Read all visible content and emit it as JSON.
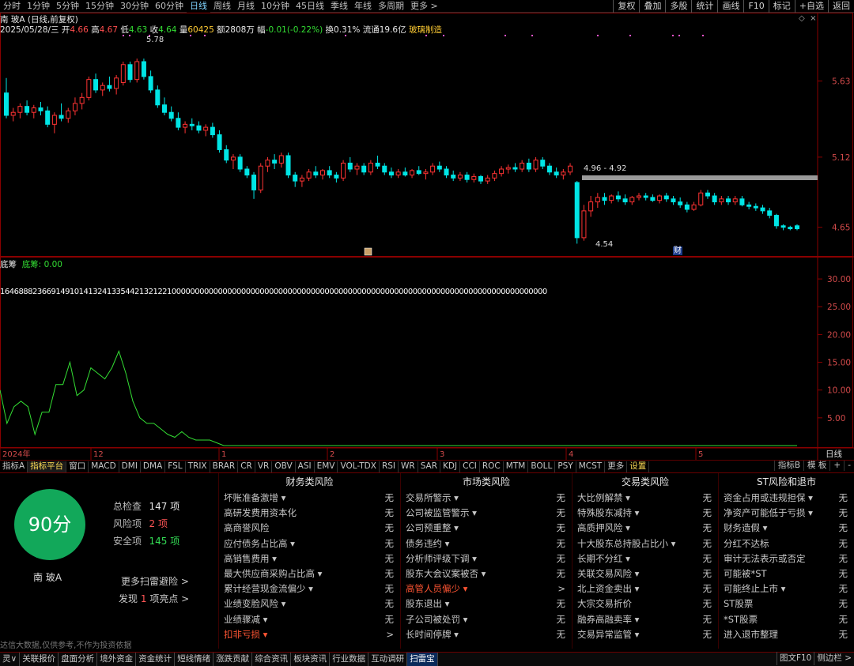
{
  "timeframes": [
    "分时",
    "1分钟",
    "5分钟",
    "15分钟",
    "30分钟",
    "60分钟",
    "日线",
    "周线",
    "月线",
    "10分钟",
    "45日线",
    "季线",
    "年线",
    "多周期",
    "更多 >"
  ],
  "active_timeframe": "日线",
  "top_buttons": [
    "复权",
    "叠加",
    "多股",
    "统计",
    "画线",
    "F10",
    "标记",
    "+自选",
    "返回"
  ],
  "stock": {
    "title": "南 玻A (日线,前复权)",
    "date": "2025/05/28/三",
    "open_label": "开",
    "open": "4.66",
    "high_label": "高",
    "high": "4.67",
    "low_label": "低",
    "low": "4.63",
    "close_label": "收",
    "close": "4.64",
    "vol_label": "量",
    "vol": "60425",
    "amt_label": "额",
    "amt": "2808万",
    "chg_label": "幅",
    "chg": "-0.01(-0.22%)",
    "turnover_label": "换",
    "turnover": "0.31%",
    "float_label": "流通",
    "float": "19.6亿",
    "sector": "玻璃制造"
  },
  "price_axis": [
    "5.63",
    "5.12",
    "4.65"
  ],
  "annotations": {
    "high": "5.78",
    "low": "4.54",
    "gap": "4.96 - 4.92",
    "fin": "财"
  },
  "indicator": {
    "name": "底筹",
    "value_label": "底筹: 0.00",
    "axis": [
      "30.00",
      "25.00",
      "20.00",
      "15.00",
      "10.00",
      "5.00"
    ],
    "digit_row": "1646888236691491014132413354421321221000000000000000000000000000000000000000000000000000000000000000000000000000000000"
  },
  "time_axis": {
    "labels": [
      "2024年",
      "12",
      "1",
      "2",
      "3",
      "4",
      "5"
    ],
    "right": "日线"
  },
  "indicator_tabs": [
    "指标A",
    "指标平台",
    "窗口",
    "MACD",
    "DMI",
    "DMA",
    "FSL",
    "TRIX",
    "BRAR",
    "CR",
    "VR",
    "OBV",
    "ASI",
    "EMV",
    "VOL-TDX",
    "RSI",
    "WR",
    "SAR",
    "KDJ",
    "CCI",
    "ROC",
    "MTM",
    "BOLL",
    "PSY",
    "MCST",
    "更多",
    "设置"
  ],
  "indicator_tabs_right": [
    "指标B",
    "模 板",
    "+",
    "-"
  ],
  "risk": {
    "score": "90分",
    "name": "南 玻A",
    "total_label": "总检查",
    "total": "147 项",
    "risk_label": "风险项",
    "risk_count": "2 项",
    "safe_label": "安全项",
    "safe_count": "145 项",
    "more": "更多扫雷避险 >",
    "found_prefix": "发现",
    "found_num": "1",
    "found_suffix": "项亮点 >",
    "columns": [
      {
        "title": "财务类风险",
        "rows": [
          {
            "name": "坏账准备激增 ▾",
            "val": "无"
          },
          {
            "name": "高研发费用资本化",
            "val": "无"
          },
          {
            "name": "高商誉风险",
            "val": "无"
          },
          {
            "name": "应付债务占比高 ▾",
            "val": "无"
          },
          {
            "name": "高销售费用 ▾",
            "val": "无"
          },
          {
            "name": "最大供应商采购占比高 ▾",
            "val": "无"
          },
          {
            "name": "累计经营现金流偏少 ▾",
            "val": "无"
          },
          {
            "name": "业绩变脸风险 ▾",
            "val": "无"
          },
          {
            "name": "业绩骤减 ▾",
            "val": "无"
          },
          {
            "name": "扣非亏损 ▾",
            "val": ">",
            "hot": true
          }
        ]
      },
      {
        "title": "市场类风险",
        "rows": [
          {
            "name": "交易所警示 ▾",
            "val": "无"
          },
          {
            "name": "公司被监管警示 ▾",
            "val": "无"
          },
          {
            "name": "公司预重整 ▾",
            "val": "无"
          },
          {
            "name": "债务违约 ▾",
            "val": "无"
          },
          {
            "name": "分析师评级下调 ▾",
            "val": "无"
          },
          {
            "name": "股东大会议案被否 ▾",
            "val": "无"
          },
          {
            "name": "高管人员偏少 ▾",
            "val": ">",
            "hot": true
          },
          {
            "name": "股东退出 ▾",
            "val": "无"
          },
          {
            "name": "子公司被处罚 ▾",
            "val": "无"
          },
          {
            "name": "长时间停牌 ▾",
            "val": "无"
          }
        ]
      },
      {
        "title": "交易类风险",
        "rows": [
          {
            "name": "大比例解禁 ▾",
            "val": "无"
          },
          {
            "name": "特殊股东减持 ▾",
            "val": "无"
          },
          {
            "name": "高质押风险 ▾",
            "val": "无"
          },
          {
            "name": "十大股东总持股占比小 ▾",
            "val": "无"
          },
          {
            "name": "长期不分红 ▾",
            "val": "无"
          },
          {
            "name": "关联交易风险 ▾",
            "val": "无"
          },
          {
            "name": "北上资金卖出 ▾",
            "val": "无"
          },
          {
            "name": "大宗交易折价",
            "val": "无"
          },
          {
            "name": "融券高融卖率 ▾",
            "val": "无"
          },
          {
            "name": "交易异常监管 ▾",
            "val": "无"
          }
        ]
      },
      {
        "title": "ST风险和退市",
        "rows": [
          {
            "name": "资金占用或违规担保 ▾",
            "val": "无"
          },
          {
            "name": "净资产可能低于亏损 ▾",
            "val": "无"
          },
          {
            "name": "财务造假 ▾",
            "val": "无"
          },
          {
            "name": "分红不达标",
            "val": "无"
          },
          {
            "name": "审计无法表示或否定",
            "val": "无"
          },
          {
            "name": "可能被*ST",
            "val": "无"
          },
          {
            "name": "可能终止上市 ▾",
            "val": "无"
          },
          {
            "name": "ST股票",
            "val": "无"
          },
          {
            "name": "*ST股票",
            "val": "无"
          },
          {
            "name": "进入退市整理",
            "val": "无"
          }
        ]
      }
    ],
    "disclaimer": "达信大数据,仅供参考,不作为投资依据"
  },
  "bottom_tabs": [
    "灵∨",
    "关联报价",
    "盘面分析",
    "境外资金",
    "资金统计",
    "短线情绪",
    "涨跌贡献",
    "综合资讯",
    "板块资讯",
    "行业数据",
    "互动调研",
    "扫雷宝"
  ],
  "bottom_active": "扫雷宝",
  "bottom_right": [
    "图文F10",
    "侧边栏 >"
  ],
  "colors": {
    "up": "#ff3333",
    "down": "#00e5e5",
    "indicator_line": "#33dd33",
    "frame": "#8a0000",
    "score_bg": "#12a85a"
  },
  "chart_data": {
    "type": "candlestick",
    "ylim": [
      4.5,
      5.85
    ],
    "candles": [
      {
        "o": 5.55,
        "h": 5.65,
        "l": 5.38,
        "c": 5.4
      },
      {
        "o": 5.4,
        "h": 5.45,
        "l": 5.36,
        "c": 5.42
      },
      {
        "o": 5.42,
        "h": 5.48,
        "l": 5.38,
        "c": 5.46
      },
      {
        "o": 5.46,
        "h": 5.5,
        "l": 5.4,
        "c": 5.42
      },
      {
        "o": 5.42,
        "h": 5.47,
        "l": 5.38,
        "c": 5.45
      },
      {
        "o": 5.45,
        "h": 5.49,
        "l": 5.4,
        "c": 5.43
      },
      {
        "o": 5.43,
        "h": 5.46,
        "l": 5.32,
        "c": 5.34
      },
      {
        "o": 5.34,
        "h": 5.42,
        "l": 5.28,
        "c": 5.4
      },
      {
        "o": 5.4,
        "h": 5.48,
        "l": 5.36,
        "c": 5.38
      },
      {
        "o": 5.38,
        "h": 5.45,
        "l": 5.35,
        "c": 5.43
      },
      {
        "o": 5.43,
        "h": 5.52,
        "l": 5.4,
        "c": 5.48
      },
      {
        "o": 5.48,
        "h": 5.55,
        "l": 5.44,
        "c": 5.52
      },
      {
        "o": 5.52,
        "h": 5.66,
        "l": 5.5,
        "c": 5.64
      },
      {
        "o": 5.64,
        "h": 5.68,
        "l": 5.55,
        "c": 5.57
      },
      {
        "o": 5.57,
        "h": 5.62,
        "l": 5.53,
        "c": 5.6
      },
      {
        "o": 5.6,
        "h": 5.66,
        "l": 5.56,
        "c": 5.58
      },
      {
        "o": 5.58,
        "h": 5.67,
        "l": 5.54,
        "c": 5.65
      },
      {
        "o": 5.62,
        "h": 5.76,
        "l": 5.6,
        "c": 5.74
      },
      {
        "o": 5.74,
        "h": 5.76,
        "l": 5.62,
        "c": 5.64
      },
      {
        "o": 5.64,
        "h": 5.78,
        "l": 5.62,
        "c": 5.76
      },
      {
        "o": 5.76,
        "h": 5.78,
        "l": 5.64,
        "c": 5.66
      },
      {
        "o": 5.66,
        "h": 5.7,
        "l": 5.55,
        "c": 5.57
      },
      {
        "o": 5.57,
        "h": 5.6,
        "l": 5.45,
        "c": 5.47
      },
      {
        "o": 5.47,
        "h": 5.52,
        "l": 5.4,
        "c": 5.42
      },
      {
        "o": 5.42,
        "h": 5.46,
        "l": 5.36,
        "c": 5.38
      },
      {
        "o": 5.38,
        "h": 5.42,
        "l": 5.3,
        "c": 5.32
      },
      {
        "o": 5.32,
        "h": 5.36,
        "l": 5.28,
        "c": 5.34
      },
      {
        "o": 5.34,
        "h": 5.38,
        "l": 5.3,
        "c": 5.33
      },
      {
        "o": 5.33,
        "h": 5.36,
        "l": 5.28,
        "c": 5.3
      },
      {
        "o": 5.3,
        "h": 5.34,
        "l": 5.26,
        "c": 5.32
      },
      {
        "o": 5.32,
        "h": 5.35,
        "l": 5.25,
        "c": 5.27
      },
      {
        "o": 5.27,
        "h": 5.3,
        "l": 5.15,
        "c": 5.17
      },
      {
        "o": 5.17,
        "h": 5.2,
        "l": 5.08,
        "c": 5.1
      },
      {
        "o": 5.1,
        "h": 5.14,
        "l": 5.04,
        "c": 5.12
      },
      {
        "o": 5.12,
        "h": 5.14,
        "l": 5.02,
        "c": 5.04
      },
      {
        "o": 5.04,
        "h": 5.06,
        "l": 4.98,
        "c": 5.0
      },
      {
        "o": 5.0,
        "h": 5.02,
        "l": 4.84,
        "c": 4.9
      },
      {
        "o": 4.9,
        "h": 5.08,
        "l": 4.88,
        "c": 5.06
      },
      {
        "o": 5.06,
        "h": 5.12,
        "l": 5.02,
        "c": 5.1
      },
      {
        "o": 5.1,
        "h": 5.14,
        "l": 5.04,
        "c": 5.08
      },
      {
        "o": 5.08,
        "h": 5.15,
        "l": 5.05,
        "c": 5.13
      },
      {
        "o": 5.13,
        "h": 5.15,
        "l": 4.98,
        "c": 5.0
      },
      {
        "o": 5.0,
        "h": 5.02,
        "l": 4.92,
        "c": 4.96
      },
      {
        "o": 4.96,
        "h": 5.0,
        "l": 4.92,
        "c": 4.98
      },
      {
        "o": 4.98,
        "h": 5.04,
        "l": 4.96,
        "c": 5.02
      },
      {
        "o": 5.02,
        "h": 5.06,
        "l": 4.98,
        "c": 5.0
      },
      {
        "o": 5.0,
        "h": 5.04,
        "l": 4.97,
        "c": 5.03
      },
      {
        "o": 5.03,
        "h": 5.06,
        "l": 4.98,
        "c": 5.0
      },
      {
        "o": 5.0,
        "h": 5.02,
        "l": 4.95,
        "c": 4.98
      },
      {
        "o": 4.98,
        "h": 5.1,
        "l": 4.96,
        "c": 5.08
      },
      {
        "o": 5.08,
        "h": 5.12,
        "l": 5.02,
        "c": 5.04
      },
      {
        "o": 5.04,
        "h": 5.08,
        "l": 5.0,
        "c": 5.06
      },
      {
        "o": 5.06,
        "h": 5.08,
        "l": 5.0,
        "c": 5.02
      },
      {
        "o": 5.02,
        "h": 5.1,
        "l": 5.0,
        "c": 5.08
      },
      {
        "o": 5.08,
        "h": 5.13,
        "l": 5.04,
        "c": 5.06
      },
      {
        "o": 5.06,
        "h": 5.08,
        "l": 5.0,
        "c": 5.02
      },
      {
        "o": 5.02,
        "h": 5.05,
        "l": 4.98,
        "c": 5.0
      },
      {
        "o": 5.0,
        "h": 5.04,
        "l": 4.98,
        "c": 5.02
      },
      {
        "o": 5.02,
        "h": 5.05,
        "l": 4.99,
        "c": 5.0
      },
      {
        "o": 5.0,
        "h": 5.04,
        "l": 4.98,
        "c": 5.03
      },
      {
        "o": 5.03,
        "h": 5.06,
        "l": 5.0,
        "c": 5.01
      },
      {
        "o": 5.01,
        "h": 5.04,
        "l": 4.97,
        "c": 5.02
      },
      {
        "o": 5.02,
        "h": 5.08,
        "l": 5.0,
        "c": 5.06
      },
      {
        "o": 5.06,
        "h": 5.09,
        "l": 5.02,
        "c": 5.04
      },
      {
        "o": 5.04,
        "h": 5.06,
        "l": 4.98,
        "c": 5.0
      },
      {
        "o": 5.0,
        "h": 5.03,
        "l": 4.96,
        "c": 4.98
      },
      {
        "o": 4.98,
        "h": 5.02,
        "l": 4.96,
        "c": 5.0
      },
      {
        "o": 5.0,
        "h": 5.02,
        "l": 4.95,
        "c": 4.97
      },
      {
        "o": 4.97,
        "h": 5.01,
        "l": 4.95,
        "c": 4.99
      },
      {
        "o": 4.99,
        "h": 5.0,
        "l": 4.94,
        "c": 4.96
      },
      {
        "o": 4.96,
        "h": 5.0,
        "l": 4.94,
        "c": 4.98
      },
      {
        "o": 4.98,
        "h": 5.03,
        "l": 4.96,
        "c": 5.01
      },
      {
        "o": 5.01,
        "h": 5.06,
        "l": 4.99,
        "c": 5.04
      },
      {
        "o": 5.04,
        "h": 5.07,
        "l": 5.01,
        "c": 5.05
      },
      {
        "o": 5.05,
        "h": 5.08,
        "l": 5.02,
        "c": 5.04
      },
      {
        "o": 5.04,
        "h": 5.1,
        "l": 5.02,
        "c": 5.08
      },
      {
        "o": 5.08,
        "h": 5.11,
        "l": 5.02,
        "c": 5.04
      },
      {
        "o": 5.04,
        "h": 5.12,
        "l": 5.02,
        "c": 5.1
      },
      {
        "o": 5.1,
        "h": 5.12,
        "l": 5.04,
        "c": 5.06
      },
      {
        "o": 5.06,
        "h": 5.08,
        "l": 5.0,
        "c": 5.02
      },
      {
        "o": 5.02,
        "h": 5.05,
        "l": 4.98,
        "c": 5.0
      },
      {
        "o": 5.0,
        "h": 5.04,
        "l": 4.97,
        "c": 5.02
      },
      {
        "o": 5.02,
        "h": 5.08,
        "l": 5.0,
        "c": 5.06
      },
      {
        "o": 4.95,
        "h": 4.96,
        "l": 4.54,
        "c": 4.58
      },
      {
        "o": 4.58,
        "h": 4.8,
        "l": 4.56,
        "c": 4.76
      },
      {
        "o": 4.76,
        "h": 4.86,
        "l": 4.72,
        "c": 4.82
      },
      {
        "o": 4.82,
        "h": 4.88,
        "l": 4.78,
        "c": 4.85
      },
      {
        "o": 4.85,
        "h": 4.88,
        "l": 4.8,
        "c": 4.83
      },
      {
        "o": 4.83,
        "h": 4.87,
        "l": 4.81,
        "c": 4.86
      },
      {
        "o": 4.86,
        "h": 4.89,
        "l": 4.82,
        "c": 4.84
      },
      {
        "o": 4.84,
        "h": 4.87,
        "l": 4.8,
        "c": 4.82
      },
      {
        "o": 4.82,
        "h": 4.86,
        "l": 4.8,
        "c": 4.85
      },
      {
        "o": 4.85,
        "h": 4.88,
        "l": 4.83,
        "c": 4.86
      },
      {
        "o": 4.86,
        "h": 4.88,
        "l": 4.83,
        "c": 4.85
      },
      {
        "o": 4.85,
        "h": 4.87,
        "l": 4.82,
        "c": 4.83
      },
      {
        "o": 4.83,
        "h": 4.87,
        "l": 4.81,
        "c": 4.86
      },
      {
        "o": 4.86,
        "h": 4.88,
        "l": 4.82,
        "c": 4.84
      },
      {
        "o": 4.84,
        "h": 4.86,
        "l": 4.8,
        "c": 4.82
      },
      {
        "o": 4.82,
        "h": 4.85,
        "l": 4.78,
        "c": 4.8
      },
      {
        "o": 4.8,
        "h": 4.82,
        "l": 4.75,
        "c": 4.77
      },
      {
        "o": 4.77,
        "h": 4.82,
        "l": 4.76,
        "c": 4.8
      },
      {
        "o": 4.8,
        "h": 4.9,
        "l": 4.79,
        "c": 4.88
      },
      {
        "o": 4.88,
        "h": 4.9,
        "l": 4.84,
        "c": 4.86
      },
      {
        "o": 4.86,
        "h": 4.88,
        "l": 4.8,
        "c": 4.82
      },
      {
        "o": 4.82,
        "h": 4.86,
        "l": 4.8,
        "c": 4.84
      },
      {
        "o": 4.84,
        "h": 4.86,
        "l": 4.8,
        "c": 4.82
      },
      {
        "o": 4.82,
        "h": 4.86,
        "l": 4.8,
        "c": 4.84
      },
      {
        "o": 4.84,
        "h": 4.86,
        "l": 4.79,
        "c": 4.8
      },
      {
        "o": 4.8,
        "h": 4.82,
        "l": 4.77,
        "c": 4.79
      },
      {
        "o": 4.79,
        "h": 4.81,
        "l": 4.76,
        "c": 4.78
      },
      {
        "o": 4.78,
        "h": 4.8,
        "l": 4.74,
        "c": 4.76
      },
      {
        "o": 4.76,
        "h": 4.78,
        "l": 4.71,
        "c": 4.73
      },
      {
        "o": 4.73,
        "h": 4.74,
        "l": 4.64,
        "c": 4.66
      },
      {
        "o": 4.66,
        "h": 4.67,
        "l": 4.63,
        "c": 4.65
      },
      {
        "o": 4.65,
        "h": 4.66,
        "l": 4.63,
        "c": 4.64
      },
      {
        "o": 4.66,
        "h": 4.67,
        "l": 4.63,
        "c": 4.64
      }
    ],
    "indicator_series": [
      10,
      4,
      7,
      8,
      7,
      2,
      6,
      6,
      11,
      11,
      15,
      9,
      10,
      14,
      13,
      12,
      14,
      17,
      13,
      8,
      5,
      4,
      4,
      3,
      2,
      1.5,
      2.5,
      1.5,
      1,
      1,
      1,
      0.5,
      0,
      0,
      0,
      0,
      0,
      0,
      0,
      0,
      0,
      0,
      0,
      0,
      0,
      0,
      0,
      0,
      0,
      0,
      0,
      0,
      0,
      0,
      0,
      0,
      0,
      0,
      0,
      0,
      0,
      0,
      0,
      0,
      0,
      0,
      0,
      0,
      0,
      0,
      0,
      0,
      0,
      0,
      0,
      0,
      0,
      0,
      0,
      0,
      0,
      0,
      0,
      0,
      0,
      0,
      0,
      0,
      0,
      0,
      0,
      0,
      0,
      0,
      0,
      0,
      0,
      0,
      0,
      0,
      0,
      0,
      0,
      0,
      0,
      0,
      0,
      0,
      0,
      0,
      0,
      0,
      0,
      0,
      0
    ],
    "indicator_ylim": [
      0,
      33
    ]
  }
}
